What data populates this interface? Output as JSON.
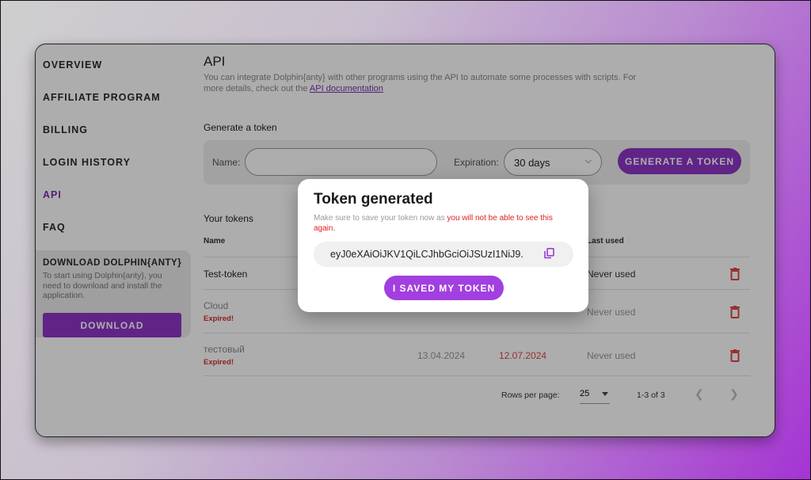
{
  "sidebar": {
    "items": [
      {
        "label": "OVERVIEW"
      },
      {
        "label": "AFFILIATE PROGRAM"
      },
      {
        "label": "BILLING"
      },
      {
        "label": "LOGIN HISTORY"
      },
      {
        "label": "API",
        "active": true
      },
      {
        "label": "FAQ"
      }
    ],
    "download_card": {
      "title": "DOWNLOAD DOLPHIN{ANTY}",
      "text": "To start using Dolphin{anty}, you need to download and install the application.",
      "button_label": "DOWNLOAD"
    }
  },
  "main": {
    "title": "API",
    "description_prefix": "You can integrate Dolphin{anty} with other programs using the API to automate some processes with scripts. For more details, check out the ",
    "description_link": "API documentation",
    "generate": {
      "section_label": "Generate a token",
      "name_label": "Name:",
      "name_value": "",
      "expiration_label": "Expiration:",
      "expiration_value": "30 days",
      "button_label": "GENERATE A TOKEN"
    },
    "tokens": {
      "section_label": "Your tokens",
      "headers": {
        "name": "Name",
        "last_used": "Last used"
      },
      "rows": [
        {
          "name": "Test-token",
          "created": "",
          "expires": "",
          "last_used": "Never used",
          "expired_label": ""
        },
        {
          "name": "Cloud",
          "created": "",
          "expires": "",
          "last_used": "Never used",
          "expired_label": "Expired!"
        },
        {
          "name": "тестовый",
          "created": "13.04.2024",
          "expires": "12.07.2024",
          "last_used": "Never used",
          "expired_label": "Expired!"
        }
      ]
    },
    "pagination": {
      "rows_per_page_label": "Rows per page:",
      "rows_per_page_value": "25",
      "range": "1-3 of 3"
    }
  },
  "modal": {
    "title": "Token generated",
    "desc_normal": "Make sure to save your token now as ",
    "desc_warning": "you will not be able to see this again.",
    "token": "eyJ0eXAiOiJKV1QiLCJhbGciOiJSUzI1NiJ9.",
    "button_label": "I SAVED MY TOKEN"
  },
  "colors": {
    "accent": "#8e35c8",
    "danger": "#e04646"
  }
}
